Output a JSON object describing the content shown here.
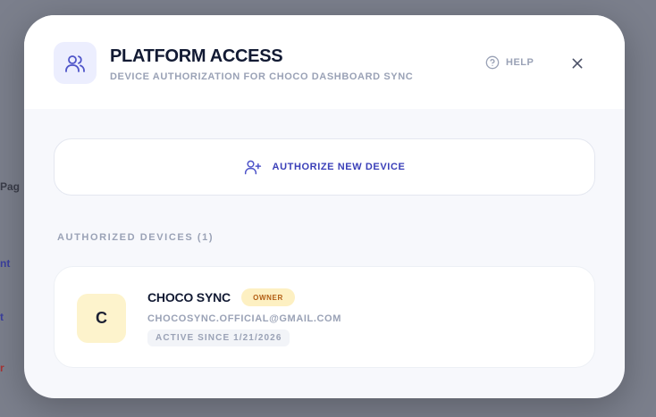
{
  "modal": {
    "title": "PLATFORM ACCESS",
    "subtitle": "DEVICE AUTHORIZATION FOR CHOCO DASHBOARD SYNC",
    "help_label": "HELP"
  },
  "actions": {
    "authorize_label": "AUTHORIZE NEW DEVICE"
  },
  "devices": {
    "section_label": "AUTHORIZED DEVICES (1)",
    "items": [
      {
        "initial": "C",
        "name": "CHOCO SYNC",
        "badge": "OWNER",
        "email": "CHOCOSYNC.OFFICIAL@GMAIL.COM",
        "active_since": "ACTIVE SINCE 1/21/2026"
      }
    ]
  },
  "icons": {
    "header": "users-icon",
    "help": "help-circle-icon",
    "close": "close-icon",
    "authorize": "user-plus-icon"
  },
  "colors": {
    "accent": "#3a3fb8",
    "title": "#121a33",
    "muted": "#9aa2b6",
    "owner_badge_bg": "#fdf0c2",
    "owner_badge_text": "#b25d12",
    "avatar_bg": "#fdf3cc"
  }
}
